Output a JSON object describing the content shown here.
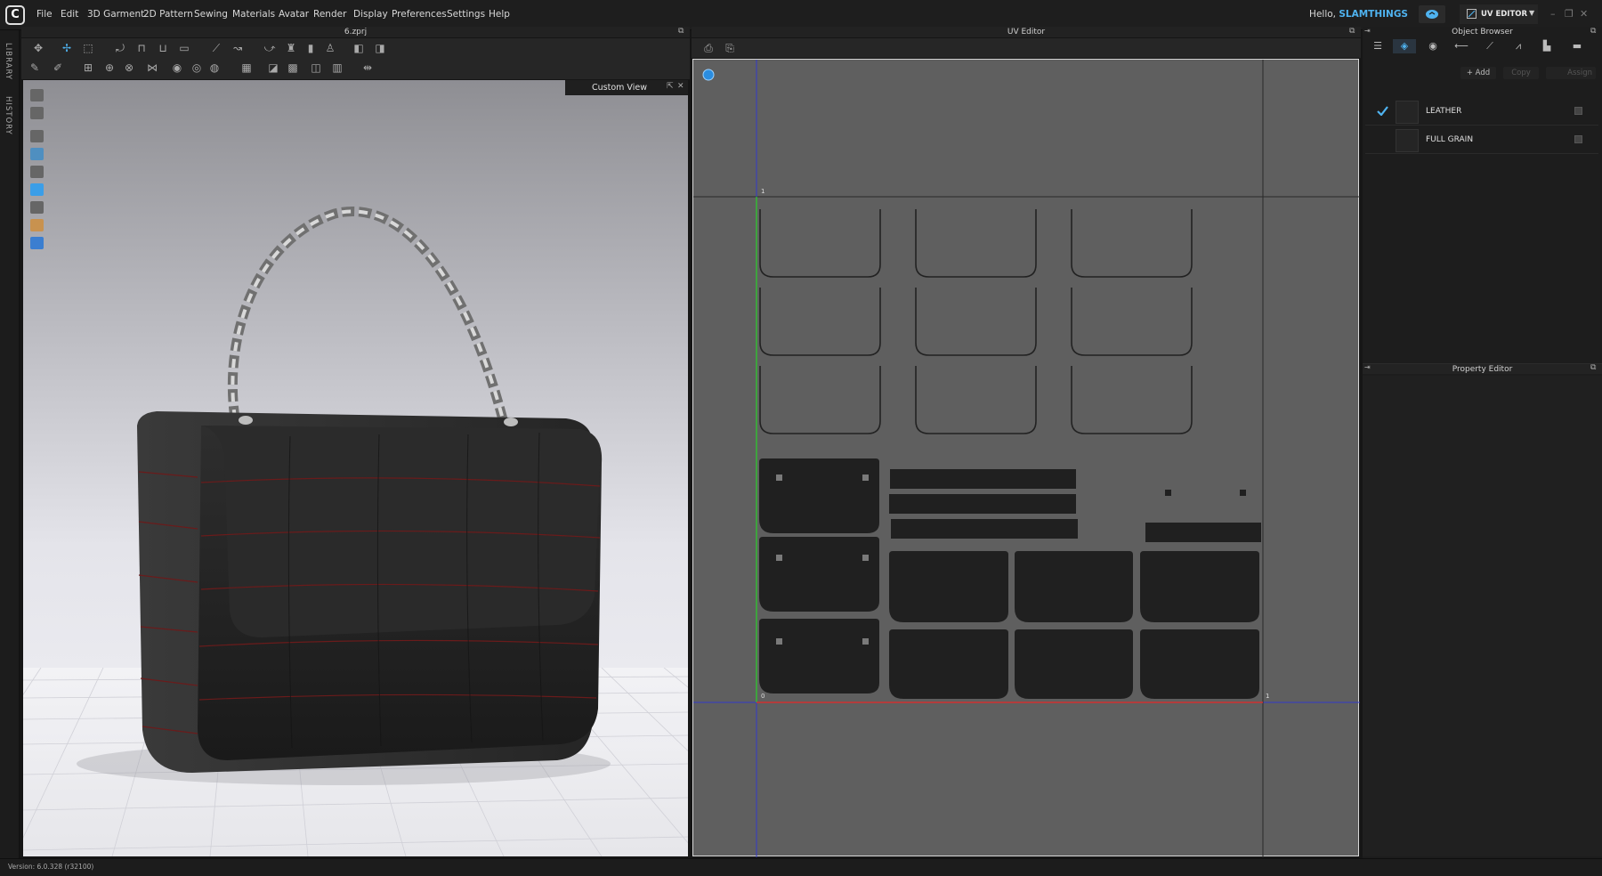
{
  "app": {
    "logo_letter": "C",
    "file_title": "6.zprj"
  },
  "menu": [
    "File",
    "Edit",
    "3D Garment",
    "2D Pattern",
    "Sewing",
    "Materials",
    "Avatar",
    "Render",
    "Display",
    "Preferences",
    "Settings",
    "Help"
  ],
  "user": {
    "greeting": "Hello,",
    "name": "SLAMTHINGS"
  },
  "mode": {
    "label": "UV EDITOR"
  },
  "sidebar": {
    "tabs": [
      "LIBRARY",
      "HISTORY"
    ]
  },
  "viewport": {
    "view_label": "Custom View"
  },
  "uv_editor": {
    "title": "UV Editor",
    "origin_label": "0",
    "unit_x_label": "1",
    "unit_y_label": "1"
  },
  "object_browser": {
    "title": "Object Browser",
    "buttons": {
      "add": "+ Add",
      "copy": "Copy",
      "assign": "Assign"
    },
    "materials": [
      {
        "name": "LEATHER",
        "selected": true
      },
      {
        "name": "FULL GRAIN",
        "selected": false
      }
    ]
  },
  "property_editor": {
    "title": "Property Editor"
  },
  "status": {
    "version": "Version: 6.0.328 (r32100)"
  },
  "colors": {
    "accent": "#4fb3f0",
    "uv_background": "#5f5f5f",
    "uv_piece": "#202020",
    "u_axis": "#d03030",
    "v_axis": "#30c030"
  },
  "icons": [
    "search-icon",
    "camera-icon",
    "list-icon",
    "fabric-icon",
    "button-icon",
    "zipper-icon",
    "topstitch-icon",
    "puckering-icon",
    "graphic-icon",
    "trim-icon",
    "checkmark-icon",
    "lock-icon"
  ]
}
